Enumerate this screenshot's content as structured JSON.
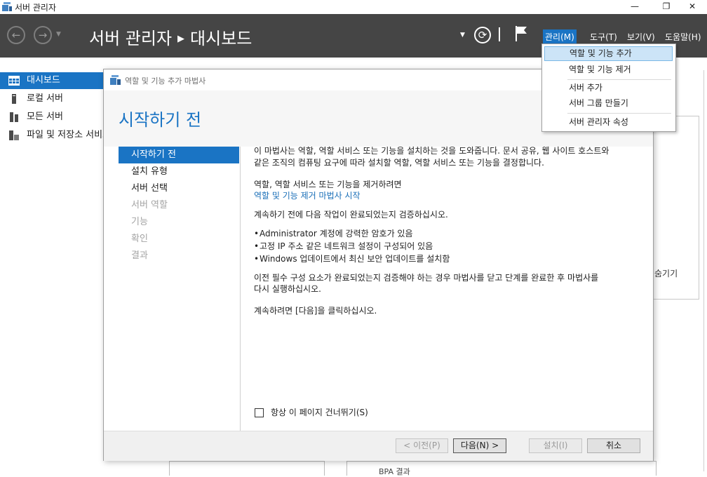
{
  "window": {
    "title": "서버 관리자",
    "minimize": "—",
    "maximize": "❐",
    "close": "✕"
  },
  "header": {
    "breadcrumb_root": "서버 관리자",
    "breadcrumb_sep": "▶",
    "breadcrumb_page": "대시보드",
    "menus": {
      "manage": "관리(M)",
      "tools": "도구(T)",
      "view": "보기(V)",
      "help": "도움말(H)"
    }
  },
  "sidebar": {
    "items": [
      {
        "label": "대시보드",
        "icon": "dashboard-icon",
        "active": true
      },
      {
        "label": "로컬 서버",
        "icon": "local-server-icon"
      },
      {
        "label": "모든 서버",
        "icon": "all-servers-icon"
      },
      {
        "label": "파일 및 저장소 서비스",
        "icon": "file-storage-icon"
      }
    ]
  },
  "background": {
    "right_text": "숨기기",
    "bottom_text": "BPA 결과"
  },
  "manage_menu": {
    "items": [
      "역할 및 기능 추가",
      "역할 및 기능 제거",
      "서버 추가",
      "서버 그룹 만들기",
      "서버 관리자 속성"
    ],
    "hovered_index": 0
  },
  "wizard": {
    "title": "역할 및 기능 추가 마법사",
    "heading": "시작하기 전",
    "steps": [
      {
        "label": "시작하기 전",
        "state": "active"
      },
      {
        "label": "설치 유형",
        "state": "enabled"
      },
      {
        "label": "서버 선택",
        "state": "enabled"
      },
      {
        "label": "서버 역할",
        "state": "disabled"
      },
      {
        "label": "기능",
        "state": "disabled"
      },
      {
        "label": "확인",
        "state": "disabled"
      },
      {
        "label": "결과",
        "state": "disabled"
      }
    ],
    "content": {
      "intro_1": "이 마법사는 역할, 역할 서비스 또는 기능을 설치하는 것을 도와줍니다. 문서 공유, 웹 사이트 호스트와",
      "intro_2": "같은 조직의 컴퓨팅 요구에 따라 설치할 역할, 역할 서비스 또는 기능을 결정합니다.",
      "remove_prompt": "역할, 역할 서비스 또는 기능을 제거하려면",
      "remove_link": "역할 및 기능 제거 마법사 시작",
      "verify": "계속하기 전에 다음 작업이 완료되었는지 검증하십시오.",
      "bullets": [
        "Administrator 계정에 강력한 암호가 있음",
        "고정 IP 주소 같은 네트워크 설정이 구성되어 있음",
        "Windows 업데이트에서 최신 보안 업데이트를 설치함"
      ],
      "prereq_1": "이전 필수 구성 요소가 완료되었는지 검증해야 하는 경우 마법사를 닫고 단계를 완료한 후 마법사를",
      "prereq_2": "다시 실행하십시오.",
      "continue": "계속하려면 [다음]을 클릭하십시오."
    },
    "skip_checkbox": {
      "label": "항상 이 페이지 건너뛰기(S)",
      "checked": false
    },
    "buttons": {
      "previous": "< 이전(P)",
      "next": "다음(N) >",
      "install": "설치(I)",
      "cancel": "취소"
    }
  },
  "colors": {
    "accent": "#1a74c4",
    "header_bg": "#454545",
    "menu_hover": "#cce4f7"
  }
}
